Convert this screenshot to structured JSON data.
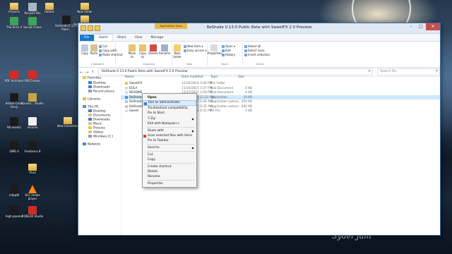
{
  "desktop": {
    "icons": [
      {
        "label": "Projects",
        "glyph": "folder-icon"
      },
      {
        "label": "Recycle Bin",
        "glyph": "recycle-bin-icon"
      },
      {
        "label": "Roblox",
        "glyph": "folder-icon"
      },
      {
        "label": "New folder",
        "glyph": "folder-icon"
      },
      {
        "label": "The Sims 4",
        "glyph": "app-icon"
      },
      {
        "label": "Social Chaos",
        "glyph": "app-icon"
      },
      {
        "label": "ReShade 0.13.0 Publi...",
        "glyph": "app-icon"
      },
      {
        "label": "ReShade 0.13.0 Publi...",
        "glyph": "folder-icon"
      },
      {
        "label": "PDF Architect",
        "glyph": "pdf-icon"
      },
      {
        "label": "PDFCreator",
        "glyph": "pdf-icon"
      },
      {
        "label": "Adobe Creat Drivy",
        "glyph": "app-icon"
      },
      {
        "label": "Konmo... Studio",
        "glyph": "app-icon"
      },
      {
        "label": "IW events",
        "glyph": "app-icon"
      },
      {
        "label": "resume",
        "glyph": "document-icon"
      },
      {
        "label": "New Converter",
        "glyph": "folder-icon"
      },
      {
        "label": "SIMS 4",
        "glyph": "app-icon"
      },
      {
        "label": "Freelance 8",
        "glyph": "app-icon"
      },
      {
        "label": "rfuss",
        "glyph": "folder-icon"
      },
      {
        "label": "mfpqW",
        "glyph": "app-icon"
      },
      {
        "label": "VLC media player",
        "glyph": "vlc-icon"
      },
      {
        "label": "high-passed",
        "glyph": "app-icon"
      },
      {
        "label": "ROBLOX Studio",
        "glyph": "app-icon"
      }
    ],
    "signature": "Sydel Jam"
  },
  "window": {
    "title": "ReShade 0.13.0 Public Beta with SweetFX 2.0 Preview",
    "contextual_tab": "Application Tools",
    "tabs": [
      "File",
      "Home",
      "Share",
      "View",
      "Manage"
    ],
    "ribbon": {
      "clipboard": {
        "copy": "Copy",
        "paste": "Paste",
        "cut": "Cut",
        "copy_path": "Copy path",
        "paste_shortcut": "Paste shortcut",
        "group": "Clipboard"
      },
      "organize": {
        "move_to": "Move to",
        "copy_to": "Copy to",
        "delete": "Delete",
        "rename": "Rename",
        "group": "Organize"
      },
      "new": {
        "new_folder": "New folder",
        "new_item": "New item ▾",
        "easy_access": "Easy access ▾",
        "group": "New"
      },
      "open": {
        "properties": "Properties",
        "open": "Open ▾",
        "edit": "Edit",
        "history": "History",
        "group": "Open"
      },
      "select": {
        "select_all": "Select all",
        "select_none": "Select none",
        "invert": "Invert selection",
        "group": "Select"
      }
    },
    "address": "ReShade 0.13.0 Public Beta with SweetFX 2.0 Preview",
    "search_placeholder": "Search Re..."
  },
  "navpane": {
    "items": [
      {
        "label": "Favorites",
        "indent": false,
        "glyph": "star-icon"
      },
      {
        "label": "Desktop",
        "indent": true,
        "glyph": "desktop-icon"
      },
      {
        "label": "Downloads",
        "indent": true,
        "glyph": "downloads-icon"
      },
      {
        "label": "Recent places",
        "indent": true,
        "glyph": "recent-icon"
      },
      {
        "label": "Libraries",
        "indent": false,
        "glyph": "libraries-icon"
      },
      {
        "label": "This PC",
        "indent": false,
        "glyph": "computer-icon"
      },
      {
        "label": "Desktop",
        "indent": true,
        "glyph": "desktop-icon"
      },
      {
        "label": "Documents",
        "indent": true,
        "glyph": "documents-icon"
      },
      {
        "label": "Downloads",
        "indent": true,
        "glyph": "downloads-icon"
      },
      {
        "label": "Music",
        "indent": true,
        "glyph": "music-icon"
      },
      {
        "label": "Pictures",
        "indent": true,
        "glyph": "pictures-icon"
      },
      {
        "label": "Videos",
        "indent": true,
        "glyph": "videos-icon"
      },
      {
        "label": "Windows (C:)",
        "indent": true,
        "glyph": "drive-icon"
      },
      {
        "label": "Network",
        "indent": false,
        "glyph": "network-icon"
      }
    ]
  },
  "filelist": {
    "headers": {
      "name": "Name",
      "date": "Date modified",
      "type": "Type",
      "size": "Size"
    },
    "rows": [
      {
        "name": "SweetFX",
        "date": "12/26/2014 3:40 PM",
        "type": "File folder",
        "size": "",
        "glyph": "folder-icon",
        "selected": false
      },
      {
        "name": "EULA",
        "date": "11/16/2015 3:27 PM",
        "type": "Text Document",
        "size": "4 KB",
        "glyph": "text-file-icon",
        "selected": false
      },
      {
        "name": "README",
        "date": "11/17/2015 3:58 PM",
        "type": "Text Document",
        "size": "4 KB",
        "glyph": "text-file-icon",
        "selected": false
      },
      {
        "name": "ReShade Setup",
        "date": "11/17/2015 12:22 AM",
        "type": "Application",
        "size": "39 KB",
        "glyph": "app-file-icon",
        "selected": true
      },
      {
        "name": "ReShade32.dll",
        "date": "11/17/2015 3:35 AM",
        "type": "Application extens...",
        "size": "350 KB",
        "glyph": "dll-file-icon",
        "selected": false
      },
      {
        "name": "ReShade64.dll",
        "date": "11/17/2015 3:35 AM",
        "type": "Application extens...",
        "size": "440 KB",
        "glyph": "dll-file-icon",
        "selected": false
      },
      {
        "name": "Sweet",
        "date": "12/29/2014 4:21 PM",
        "type": "FX File",
        "size": "4 KB",
        "glyph": "fx-file-icon",
        "selected": false
      }
    ]
  },
  "context_menu": {
    "items": [
      {
        "label": "Open",
        "bold": true,
        "sub": false
      },
      {
        "label": "Run as administrator",
        "bold": false,
        "sub": false,
        "highlight": true
      },
      {
        "label": "Troubleshoot compatibility",
        "bold": false,
        "sub": false
      },
      {
        "label": "Pin to Start",
        "bold": false,
        "sub": false
      },
      {
        "label": "7-Zip",
        "bold": false,
        "sub": true
      },
      {
        "label": "Edit with Notepad++",
        "bold": false,
        "sub": false
      },
      {
        "label": "Share with",
        "bold": false,
        "sub": true
      },
      {
        "label": "Scan selected files with Avira",
        "bold": false,
        "sub": false
      },
      {
        "label": "Pin to Taskbar",
        "bold": false,
        "sub": false
      },
      {
        "label": "Send to",
        "bold": false,
        "sub": true
      },
      {
        "label": "Cut",
        "bold": false,
        "sub": false
      },
      {
        "label": "Copy",
        "bold": false,
        "sub": false
      },
      {
        "label": "Create shortcut",
        "bold": false,
        "sub": false
      },
      {
        "label": "Delete",
        "bold": false,
        "sub": false
      },
      {
        "label": "Rename",
        "bold": false,
        "sub": false
      },
      {
        "label": "Properties",
        "bold": false,
        "sub": false
      }
    ]
  },
  "colors": {
    "accent": "#1979ca",
    "selection": "#cce8ff",
    "contextual_tab": "#e8b94b",
    "close_button": "#c75050"
  }
}
